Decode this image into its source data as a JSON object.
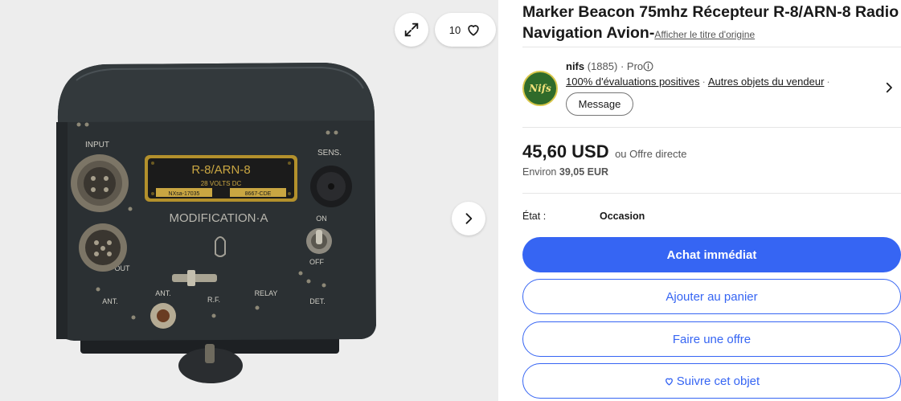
{
  "gallery": {
    "watch_count": "10",
    "device": {
      "model": "R-8/ARN-8",
      "voltage": "28 VOLTS DC",
      "serial": "NXsa-17035",
      "code": "8667-CDE",
      "modification": "MODIFICATION·A",
      "labels": {
        "input": "INPUT",
        "sens": "SENS.",
        "on": "ON",
        "off": "OFF",
        "out": "OUT",
        "ant_left": "ANT.",
        "ant": "ANT.",
        "rf": "R.F.",
        "relay": "RELAY",
        "det": "DET."
      }
    }
  },
  "listing": {
    "title": "Marker Beacon 75mhz Récepteur R-8/ARN-8 Radio Navigation Avion-",
    "original_title_link": "Afficher le titre d'origine"
  },
  "seller": {
    "name": "nifs",
    "feedback_count": "(1885)",
    "separator": "·",
    "badge": "Pro",
    "positive_feedback": "100% d'évaluations positives",
    "other_items": "Autres objets du vendeur",
    "message_button": "Message",
    "avatar_text": "Nifs"
  },
  "price": {
    "amount": "45,60 USD",
    "alt": "ou Offre directe",
    "approx_label": "Environ",
    "approx_value": "39,05 EUR"
  },
  "condition": {
    "label": "État :",
    "value": "Occasion"
  },
  "actions": {
    "buy_now": "Achat immédiat",
    "add_to_cart": "Ajouter au panier",
    "make_offer": "Faire une offre",
    "watch": "Suivre cet objet"
  },
  "colors": {
    "primary": "#3665f3",
    "text": "#191919",
    "muted": "#555555"
  }
}
